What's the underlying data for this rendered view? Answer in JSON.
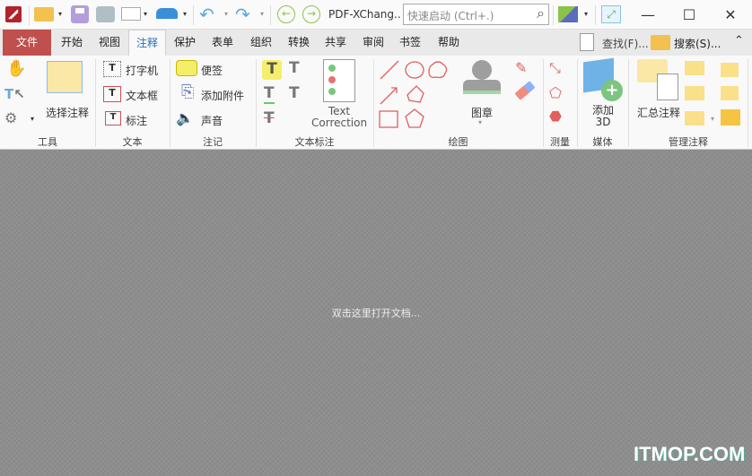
{
  "titlebar": {
    "doc_title": "PDF-XChang..",
    "search_placeholder": "快速启动 (Ctrl+.)"
  },
  "tabs": [
    {
      "label": "文件"
    },
    {
      "label": "开始"
    },
    {
      "label": "视图"
    },
    {
      "label": "注释"
    },
    {
      "label": "保护"
    },
    {
      "label": "表单"
    },
    {
      "label": "组织"
    },
    {
      "label": "转换"
    },
    {
      "label": "共享"
    },
    {
      "label": "审阅"
    },
    {
      "label": "书签"
    },
    {
      "label": "帮助"
    }
  ],
  "active_tab": "注释",
  "tabbar_right": {
    "find": "查找(F)...",
    "search": "搜索(S)..."
  },
  "ribbon": {
    "tools": {
      "label": "工具",
      "select_annotation": "选择注释"
    },
    "text": {
      "label": "文本",
      "typewriter": "打字机",
      "textbox": "文本框",
      "callout": "标注"
    },
    "notes": {
      "label": "注记",
      "sticky": "便签",
      "attach": "添加附件",
      "sound": "声音"
    },
    "markup": {
      "label": "文本标注",
      "text_correction_1": "Text",
      "text_correction_2": "Correction"
    },
    "drawing": {
      "label": "绘图",
      "stamp": "图章"
    },
    "measure": {
      "label": "测量"
    },
    "media": {
      "label": "媒体",
      "add3d_1": "添加",
      "add3d_2": "3D"
    },
    "manage": {
      "label": "管理注释",
      "summarize": "汇总注释"
    }
  },
  "document": {
    "hint": "双击这里打开文档..."
  },
  "watermark": "ITMOP.COM",
  "colors": {
    "file_tab": "#c0504d",
    "accent": "#2a6fb5",
    "doc_bg": "#8e8e8e",
    "shape_red": "#e06060"
  }
}
